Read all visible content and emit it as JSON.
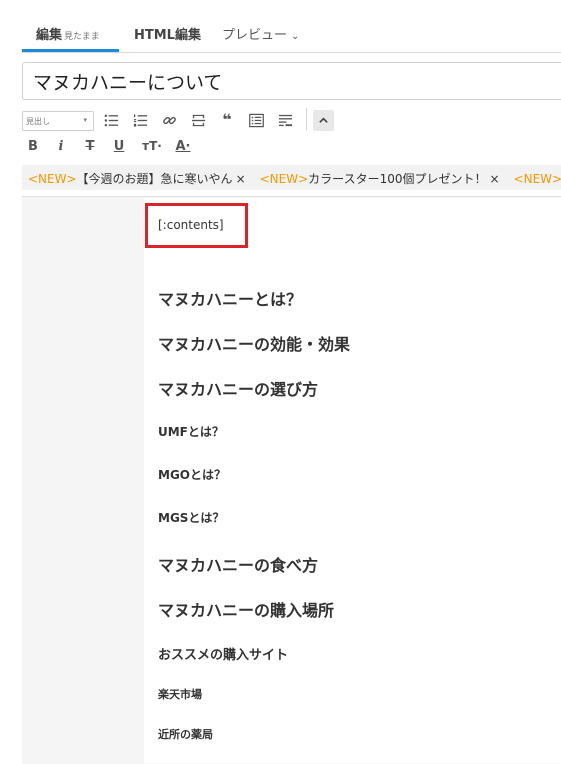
{
  "tabs": {
    "edit_label": "編集",
    "edit_sub": "見たまま",
    "html_label": "HTML編集",
    "preview_label": "プレビュー",
    "preview_chevron": "⌄"
  },
  "title": {
    "value": "マヌカハニーについて"
  },
  "toolbar": {
    "heading_select_value": "見出し",
    "heading_select_arrow": "▾",
    "bold": "B",
    "italic": "i",
    "strike": "T",
    "underline": "U",
    "fontsize": "тT·",
    "fontcolor": "A·",
    "quote": "❝",
    "icons": [
      "list-bulleted-icon",
      "list-numbered-icon",
      "link-icon",
      "horizontal-rule-icon",
      "quote-icon",
      "table-of-contents-icon",
      "more-icon",
      "collapse-toolbar-icon"
    ]
  },
  "ticker": [
    {
      "tag": "<NEW>",
      "text": "【今週のお題】急に寒いやん",
      "close": "×"
    },
    {
      "tag": "<NEW>",
      "text": "カラースター100個プレゼント！",
      "close": "×"
    },
    {
      "tag": "<NEW>",
      "text": "",
      "close": ""
    }
  ],
  "editor": {
    "contents_tag": "[:contents]",
    "headings": [
      {
        "level": "h2",
        "text": "マヌカハニーとは？"
      },
      {
        "level": "h2",
        "text": "マヌカハニーの効能・効果"
      },
      {
        "level": "h2",
        "text": "マヌカハニーの選び方"
      },
      {
        "level": "h4",
        "text": "UMFとは？"
      },
      {
        "level": "h4",
        "text": "MGOとは？"
      },
      {
        "level": "h4",
        "text": "MGSとは？"
      },
      {
        "level": "h2",
        "text": "マヌカハニーの食べ方"
      },
      {
        "level": "h2",
        "text": "マヌカハニーの購入場所"
      },
      {
        "level": "h3",
        "text": "おススメの購入サイト"
      },
      {
        "level": "h4",
        "text": "楽天市場"
      },
      {
        "level": "h4",
        "text": "近所の薬局"
      }
    ]
  },
  "colors": {
    "tab_accent": "#1c8ad6",
    "highlight_box": "#d9252a",
    "new_tag": "#f39800"
  }
}
